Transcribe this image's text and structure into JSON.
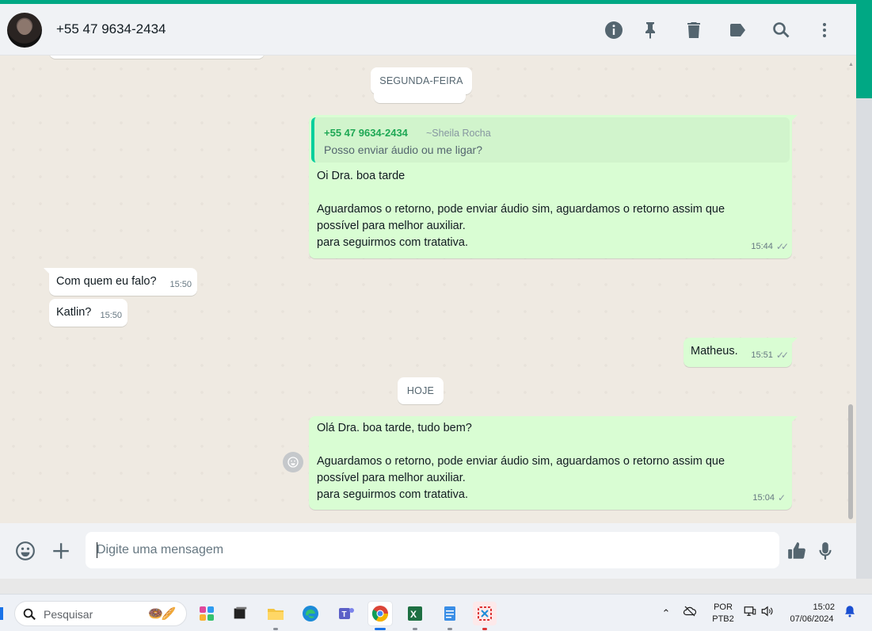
{
  "colors": {
    "accent": "#00a884",
    "outgoing_bubble": "#d9fdd3",
    "incoming_bubble": "#ffffff",
    "chat_bg": "#efeae2",
    "quote_author": "#1fa855"
  },
  "header": {
    "contact_name": "+55 47 9634-2434",
    "icons": [
      "info-icon",
      "pin-icon",
      "delete-icon",
      "label-icon",
      "search-icon",
      "menu-icon"
    ]
  },
  "chat": {
    "date_separators": {
      "monday": "SEGUNDA-FEIRA",
      "today": "HOJE"
    },
    "messages": [
      {
        "direction": "out",
        "quoted": {
          "author": "+55 47 9634-2434",
          "push_name": "~Sheila Rocha",
          "text": "Posso enviar áudio ou me ligar?"
        },
        "lines": [
          "Oi Dra. boa tarde",
          "Aguardamos o retorno, pode enviar áudio sim, aguardamos o retorno assim que",
          "possível para melhor auxiliar.",
          "para seguirmos com tratativa."
        ],
        "time": "15:44",
        "status": "read"
      },
      {
        "direction": "in",
        "text": "Com quem eu falo?",
        "time": "15:50"
      },
      {
        "direction": "in",
        "text": "Katlin?",
        "time": "15:50"
      },
      {
        "direction": "out",
        "text": "Matheus.",
        "time": "15:51",
        "status": "read"
      },
      {
        "direction": "out",
        "lines": [
          "Olá Dra. boa tarde, tudo bem?",
          "Aguardamos o retorno, pode enviar áudio sim, aguardamos o retorno assim que",
          "possível para melhor auxiliar.",
          "para seguirmos com tratativa."
        ],
        "time": "15:04",
        "status": "sent"
      }
    ]
  },
  "composer": {
    "placeholder": "Digite uma mensagem",
    "value": ""
  },
  "taskbar": {
    "search_label": "Pesquisar",
    "apps": [
      "copilot-icon",
      "task-view-icon",
      "file-explorer-icon",
      "edge-icon",
      "teams-icon",
      "chrome-icon",
      "excel-icon",
      "notepad-icon",
      "snipping-tool-icon"
    ],
    "active_app": "chrome-icon",
    "language_top": "POR",
    "language_bottom": "PTB2",
    "time": "15:02",
    "date": "07/06/2024"
  }
}
